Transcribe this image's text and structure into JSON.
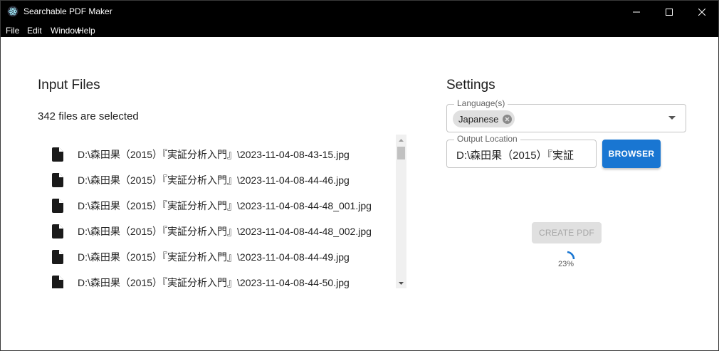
{
  "window": {
    "title": "Searchable PDF Maker",
    "icon": "electron-atom-icon"
  },
  "menu": [
    "File",
    "Edit",
    "Window",
    "Help"
  ],
  "input": {
    "title": "Input Files",
    "count_text": "342 files are selected",
    "files": [
      "D:\\森田果（2015）『実証分析入門』\\2023-11-04-08-43-15.jpg",
      "D:\\森田果（2015）『実証分析入門』\\2023-11-04-08-44-46.jpg",
      "D:\\森田果（2015）『実証分析入門』\\2023-11-04-08-44-48_001.jpg",
      "D:\\森田果（2015）『実証分析入門』\\2023-11-04-08-44-48_002.jpg",
      "D:\\森田果（2015）『実証分析入門』\\2023-11-04-08-44-49.jpg",
      "D:\\森田果（2015）『実証分析入門』\\2023-11-04-08-44-50.jpg"
    ]
  },
  "settings": {
    "title": "Settings",
    "language_label": "Language(s)",
    "language_chip": "Japanese",
    "output_label": "Output Location",
    "output_value": "D:\\森田果（2015）『実証",
    "browse_label": "BROWSER",
    "create_label": "CREATE PDF",
    "progress_text": "23%",
    "progress_value": 0.23
  },
  "colors": {
    "accent": "#1976d2",
    "titlebar": "#000000"
  }
}
